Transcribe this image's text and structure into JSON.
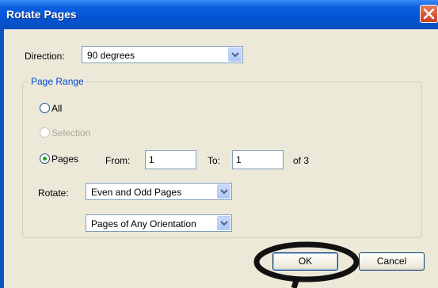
{
  "window": {
    "title": "Rotate Pages"
  },
  "direction": {
    "label": "Direction:",
    "value": "90 degrees"
  },
  "page_range": {
    "legend": "Page Range",
    "all_label": "All",
    "selection_label": "Selection",
    "pages_label": "Pages",
    "from_label": "From:",
    "from_value": "1",
    "to_label": "To:",
    "to_value": "1",
    "of_label": "of 3",
    "selected": "Pages"
  },
  "rotate": {
    "label": "Rotate:",
    "parity_value": "Even and Odd Pages",
    "orientation_value": "Pages of Any Orientation"
  },
  "buttons": {
    "ok": "OK",
    "cancel": "Cancel"
  },
  "colors": {
    "title_bar": "#0a5fe0",
    "legend_text": "#0046d5",
    "annotation": "#111111"
  }
}
